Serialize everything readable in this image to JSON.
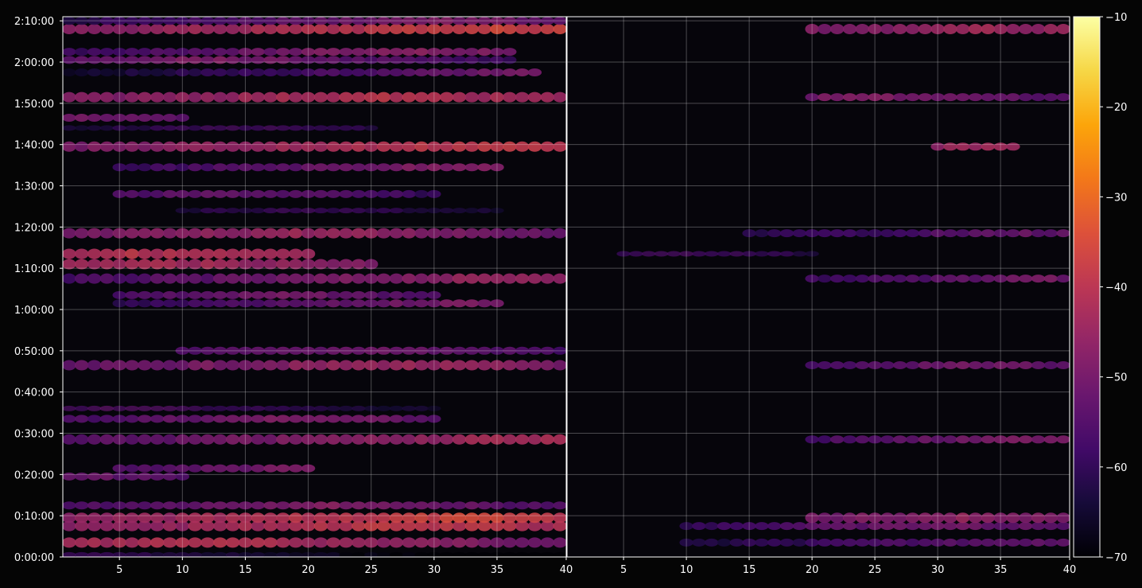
{
  "chart_data": {
    "type": "heatmap",
    "panels": [
      {
        "name": "",
        "x_ticks": [
          "5",
          "10",
          "15",
          "20",
          "25",
          "30",
          "35",
          "40"
        ],
        "x_range": [
          1,
          40
        ],
        "y_range_seconds": [
          0,
          7860
        ],
        "rows": [
          {
            "t": "0:00:30",
            "level": "low",
            "x_from": 1,
            "x_to": 40,
            "peak_x": 0,
            "peak": -55
          },
          {
            "t": "0:03:30",
            "level": "high",
            "x_from": 1,
            "x_to": 40,
            "peak_x": 11,
            "peak": -38
          },
          {
            "t": "0:07:30",
            "level": "high",
            "x_from": 1,
            "x_to": 40,
            "peak_x": 28,
            "peak": -36
          },
          {
            "t": "0:09:30",
            "level": "high",
            "x_from": 1,
            "x_to": 40,
            "peak_x": 33,
            "peak": -34
          },
          {
            "t": "0:12:30",
            "level": "mid",
            "x_from": 1,
            "x_to": 40,
            "peak_x": 21,
            "peak": -45
          },
          {
            "t": "0:19:30",
            "level": "mid",
            "x_from": 1,
            "x_to": 10,
            "peak_x": 3,
            "peak": -50
          },
          {
            "t": "0:21:30",
            "level": "mid",
            "x_from": 5,
            "x_to": 20,
            "peak_x": 19,
            "peak": -47
          },
          {
            "t": "0:28:30",
            "level": "high",
            "x_from": 1,
            "x_to": 40,
            "peak_x": 38,
            "peak": -40
          },
          {
            "t": "0:33:30",
            "level": "mid",
            "x_from": 1,
            "x_to": 30,
            "peak_x": 19,
            "peak": -46
          },
          {
            "t": "0:36:00",
            "level": "low",
            "x_from": 1,
            "x_to": 30,
            "peak_x": 5,
            "peak": -52
          },
          {
            "t": "0:46:30",
            "level": "high",
            "x_from": 1,
            "x_to": 40,
            "peak_x": 27,
            "peak": -42
          },
          {
            "t": "0:50:00",
            "level": "mid",
            "x_from": 10,
            "x_to": 40,
            "peak_x": 25,
            "peak": -48
          },
          {
            "t": "1:01:30",
            "level": "mid",
            "x_from": 5,
            "x_to": 35,
            "peak_x": 33,
            "peak": -46
          },
          {
            "t": "1:03:30",
            "level": "mid",
            "x_from": 5,
            "x_to": 30,
            "peak_x": 18,
            "peak": -48
          },
          {
            "t": "1:07:30",
            "level": "high",
            "x_from": 1,
            "x_to": 40,
            "peak_x": 38,
            "peak": -42
          },
          {
            "t": "1:11:00",
            "level": "high",
            "x_from": 1,
            "x_to": 25,
            "peak_x": 8,
            "peak": -40
          },
          {
            "t": "1:13:30",
            "level": "high",
            "x_from": 1,
            "x_to": 20,
            "peak_x": 6,
            "peak": -38
          },
          {
            "t": "1:18:30",
            "level": "high",
            "x_from": 1,
            "x_to": 40,
            "peak_x": 19,
            "peak": -42
          },
          {
            "t": "1:24:00",
            "level": "low",
            "x_from": 10,
            "x_to": 35,
            "peak_x": 20,
            "peak": -55
          },
          {
            "t": "1:28:00",
            "level": "mid",
            "x_from": 5,
            "x_to": 30,
            "peak_x": 14,
            "peak": -50
          },
          {
            "t": "1:34:30",
            "level": "mid",
            "x_from": 5,
            "x_to": 35,
            "peak_x": 34,
            "peak": -44
          },
          {
            "t": "1:39:30",
            "level": "high",
            "x_from": 1,
            "x_to": 40,
            "peak_x": 34,
            "peak": -36
          },
          {
            "t": "1:44:00",
            "level": "low",
            "x_from": 1,
            "x_to": 25,
            "peak_x": 15,
            "peak": -54
          },
          {
            "t": "1:46:30",
            "level": "mid",
            "x_from": 1,
            "x_to": 10,
            "peak_x": 2,
            "peak": -48
          },
          {
            "t": "1:51:30",
            "level": "high",
            "x_from": 1,
            "x_to": 40,
            "peak_x": 26,
            "peak": -38
          },
          {
            "t": "1:57:30",
            "level": "mid",
            "x_from": 1,
            "x_to": 38,
            "peak_x": 36,
            "peak": -48
          },
          {
            "t": "2:00:30",
            "level": "mid",
            "x_from": 1,
            "x_to": 36,
            "peak_x": 11,
            "peak": -46
          },
          {
            "t": "2:02:30",
            "level": "mid",
            "x_from": 1,
            "x_to": 36,
            "peak_x": 28,
            "peak": -44
          },
          {
            "t": "2:08:00",
            "level": "high",
            "x_from": 1,
            "x_to": 40,
            "peak_x": 35,
            "peak": -34
          },
          {
            "t": "2:10:00",
            "level": "mid",
            "x_from": 1,
            "x_to": 40,
            "peak_x": 30,
            "peak": -46
          }
        ]
      },
      {
        "name": "",
        "x_ticks": [
          "5",
          "10",
          "15",
          "20",
          "25",
          "30",
          "35",
          "40"
        ],
        "x_range": [
          1,
          40
        ],
        "y_range_seconds": [
          0,
          7860
        ],
        "rows": [
          {
            "t": "0:03:30",
            "level": "mid",
            "x_from": 10,
            "x_to": 40,
            "peak_x": 36,
            "peak": -50
          },
          {
            "t": "0:07:30",
            "level": "mid",
            "x_from": 10,
            "x_to": 40,
            "peak_x": 30,
            "peak": -48
          },
          {
            "t": "0:09:30",
            "level": "high",
            "x_from": 20,
            "x_to": 40,
            "peak_x": 32,
            "peak": -44
          },
          {
            "t": "0:28:30",
            "level": "mid",
            "x_from": 20,
            "x_to": 40,
            "peak_x": 39,
            "peak": -46
          },
          {
            "t": "0:46:30",
            "level": "mid",
            "x_from": 20,
            "x_to": 40,
            "peak_x": 33,
            "peak": -48
          },
          {
            "t": "1:07:30",
            "level": "mid",
            "x_from": 20,
            "x_to": 40,
            "peak_x": 39,
            "peak": -48
          },
          {
            "t": "1:13:30",
            "level": "low",
            "x_from": 5,
            "x_to": 20,
            "peak_x": 10,
            "peak": -54
          },
          {
            "t": "1:18:30",
            "level": "mid",
            "x_from": 15,
            "x_to": 40,
            "peak_x": 37,
            "peak": -50
          },
          {
            "t": "1:39:30",
            "level": "mid",
            "x_from": 30,
            "x_to": 36,
            "peak_x": 33,
            "peak": -42
          },
          {
            "t": "1:51:30",
            "level": "mid",
            "x_from": 20,
            "x_to": 40,
            "peak_x": 25,
            "peak": -46
          },
          {
            "t": "2:08:00",
            "level": "high",
            "x_from": 20,
            "x_to": 40,
            "peak_x": 34,
            "peak": -42
          }
        ]
      }
    ],
    "y_ticks": [
      "0:00:00",
      "0:10:00",
      "0:20:00",
      "0:30:00",
      "0:40:00",
      "0:50:00",
      "1:00:00",
      "1:10:00",
      "1:20:00",
      "1:30:00",
      "1:40:00",
      "1:50:00",
      "2:00:00",
      "2:10:00"
    ],
    "colorbar": {
      "colormap": "inferno",
      "range": [
        -70,
        -10
      ],
      "ticks": [
        "−10",
        "−20",
        "−30",
        "−40",
        "−50",
        "−60",
        "−70"
      ]
    },
    "grid": true,
    "colors": {
      "background": "#050505",
      "axis": "#ffffff"
    }
  }
}
